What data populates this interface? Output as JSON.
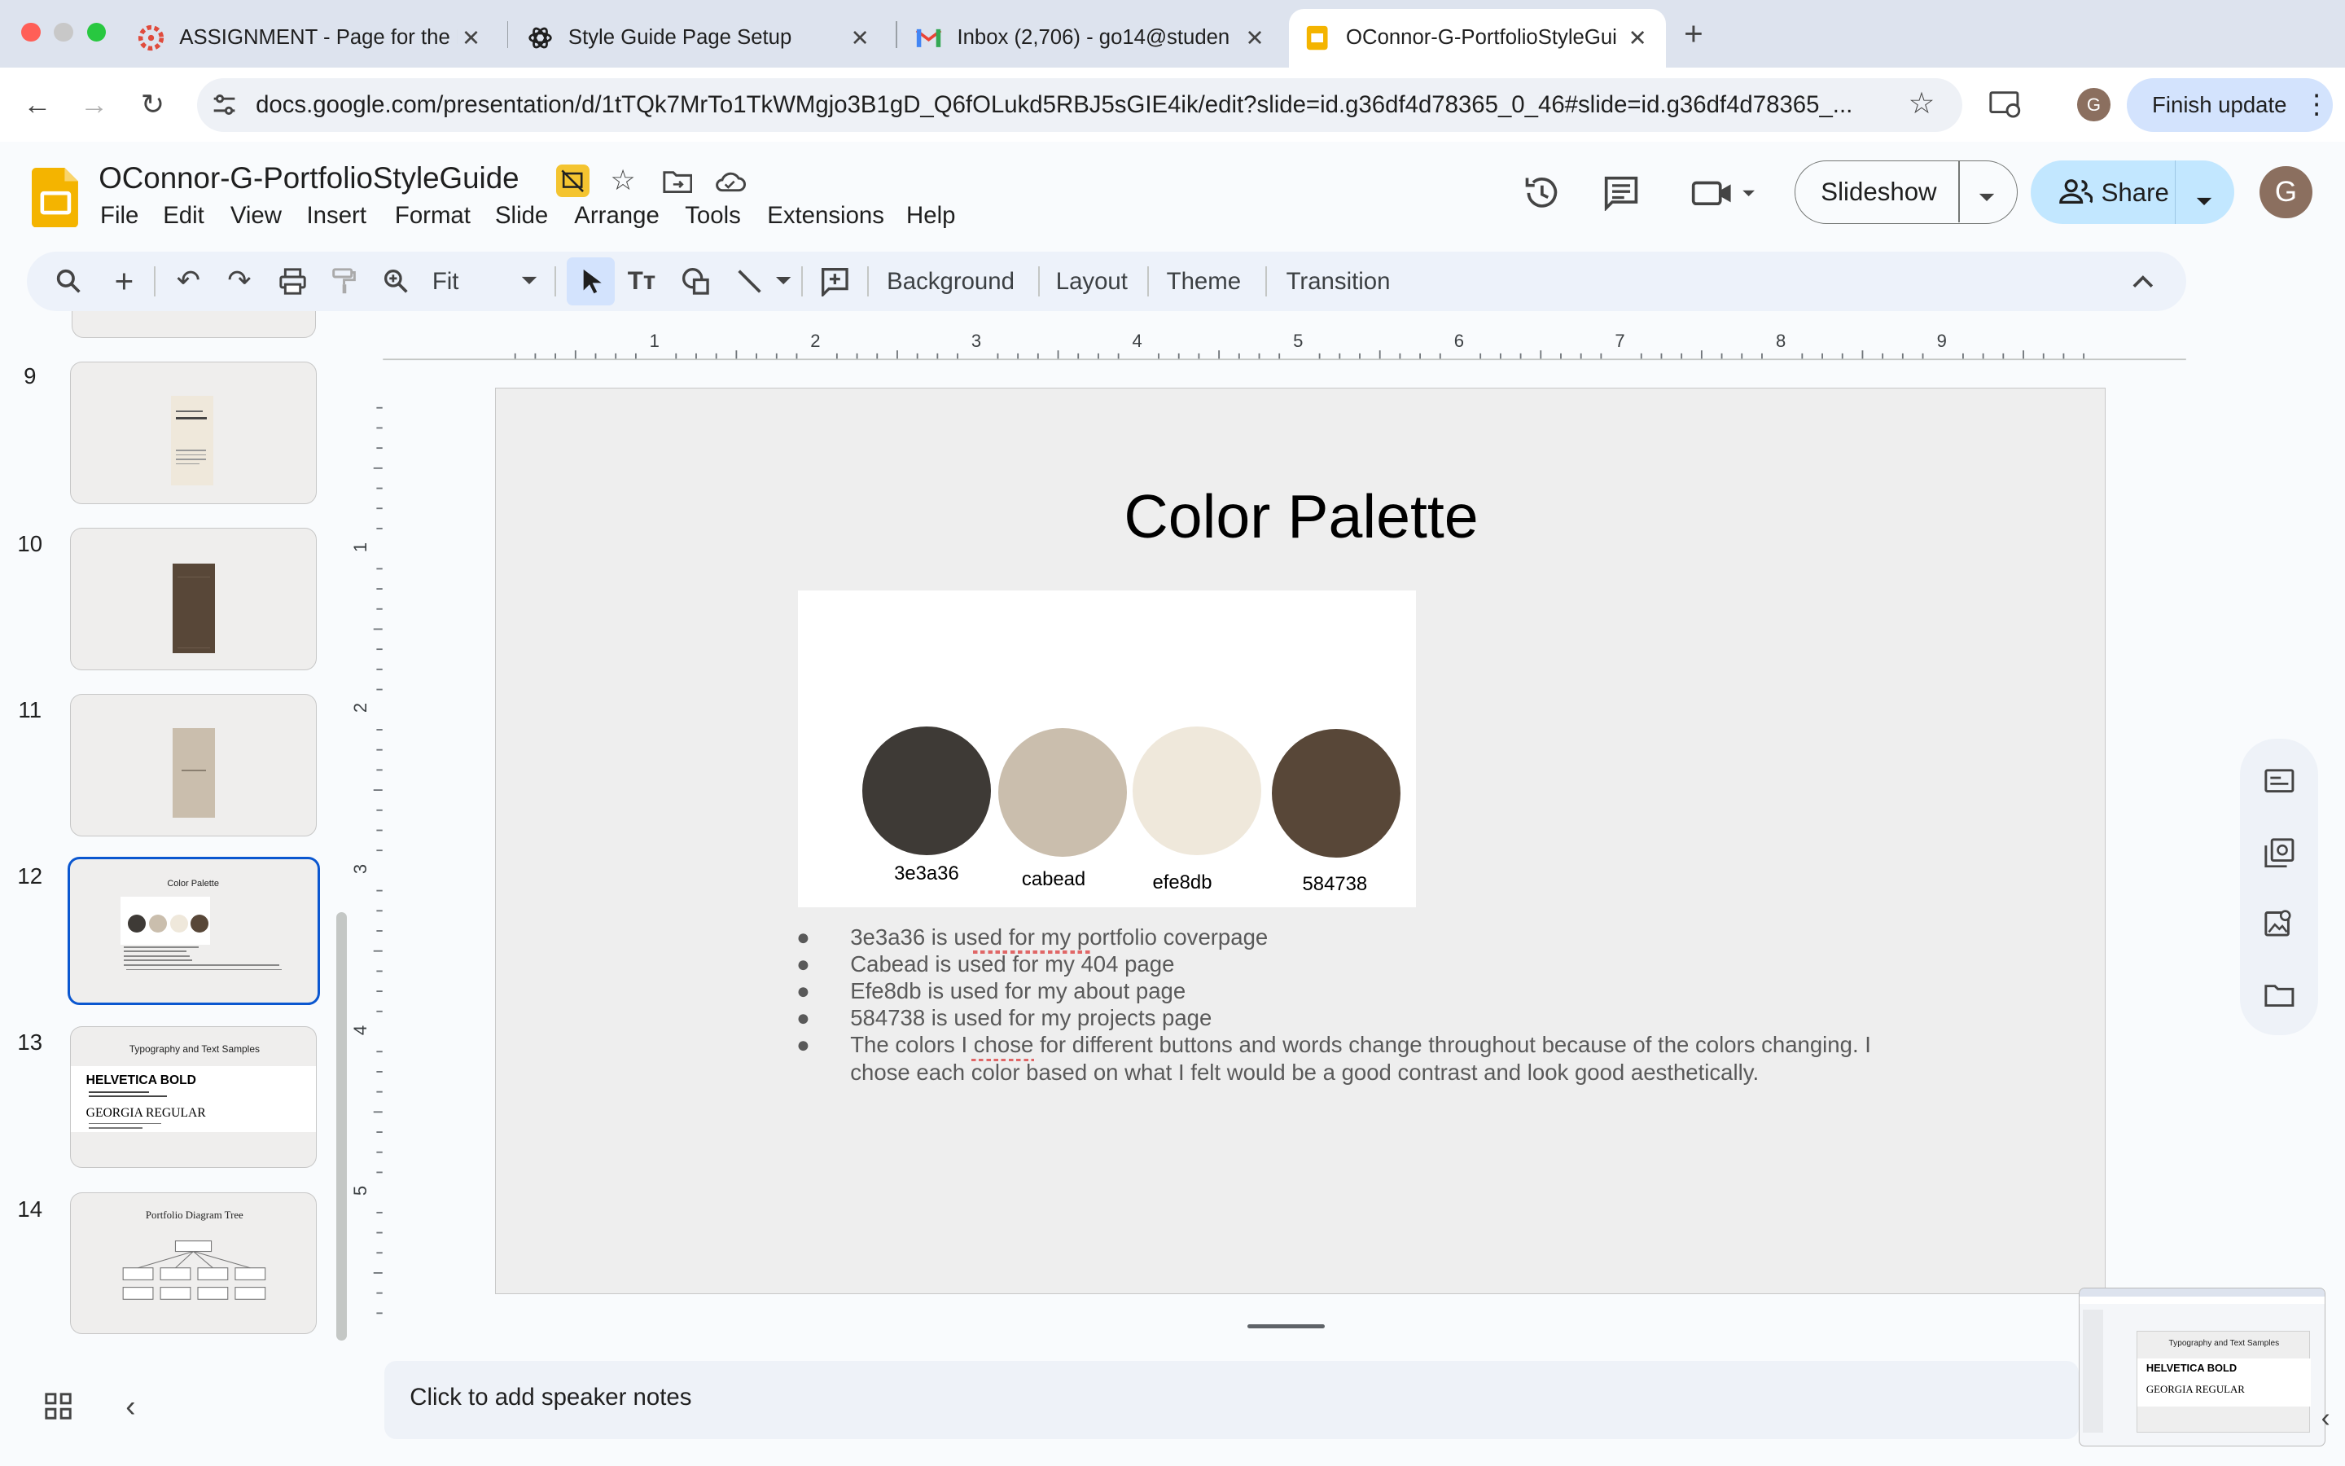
{
  "browser": {
    "tabs": [
      {
        "title": "ASSIGNMENT - Page for the P",
        "icon": "canvas-icon",
        "color": "#e04b3c"
      },
      {
        "title": "Style Guide Page Setup",
        "icon": "openai-icon",
        "color": "#1f1f1f"
      },
      {
        "title": "Inbox (2,706) - go14@studen",
        "icon": "gmail-icon",
        "color": "#ea4335"
      },
      {
        "title": "OConnor-G-PortfolioStyleGui",
        "icon": "slides-icon",
        "color": "#f4b400"
      }
    ],
    "url": "docs.google.com/presentation/d/1tTQk7MrTo1TkWMgjo3B1gD_Q6fOLukd5RBJ5sGIE4ik/edit?slide=id.g36df4d78365_0_46#slide=id.g36df4d78365_...",
    "profile_initial": "G",
    "finish_update": "Finish update"
  },
  "app": {
    "doc_title": "OConnor-G-PortfolioStyleGuide",
    "menus": [
      "File",
      "Edit",
      "View",
      "Insert",
      "Format",
      "Slide",
      "Arrange",
      "Tools",
      "Extensions",
      "Help"
    ],
    "slideshow_label": "Slideshow",
    "share_label": "Share",
    "account_initial": "G",
    "brand_color": "#f4b400",
    "share_color": "#c2e7ff"
  },
  "toolbar": {
    "zoom": "Fit",
    "background": "Background",
    "layout": "Layout",
    "theme": "Theme",
    "transition": "Transition"
  },
  "ruler": {
    "h_labels": [
      "1",
      "2",
      "3",
      "4",
      "5",
      "6",
      "7",
      "8",
      "9"
    ],
    "v_labels": [
      "1",
      "2",
      "3",
      "4",
      "5"
    ]
  },
  "filmstrip": {
    "numbers": [
      "9",
      "10",
      "11",
      "12",
      "13",
      "14"
    ],
    "selected": "12",
    "slide12_title": "Color Palette",
    "slide13_title": "Typography and Text Samples",
    "slide13_heading1": "HELVETICA BOLD",
    "slide13_heading2": "GEORGIA REGULAR",
    "slide14_title": "Portfolio Diagram Tree"
  },
  "slide": {
    "title": "Color Palette",
    "swatches": [
      {
        "label": "3e3a36",
        "color": "#3e3a36"
      },
      {
        "label": "cabead",
        "color": "#cabead"
      },
      {
        "label": "efe8db",
        "color": "#efe8db"
      },
      {
        "label": "584738",
        "color": "#584738"
      }
    ],
    "bullets": [
      "3e3a36 is used for my portfolio coverpage",
      "Cabead is used for my 404 page",
      "Efe8db is used for my about page",
      "584738 is used for my projects page",
      "The colors I chose for different buttons and words change throughout because of the colors changing. I chose each color based on what I felt would be a good contrast and look good aesthetically."
    ]
  },
  "notes": {
    "placeholder": "Click to add speaker notes"
  },
  "preview": {
    "title": "Typography and Text Samples",
    "heading1": "HELVETICA BOLD",
    "heading2": "GEORGIA REGULAR"
  }
}
